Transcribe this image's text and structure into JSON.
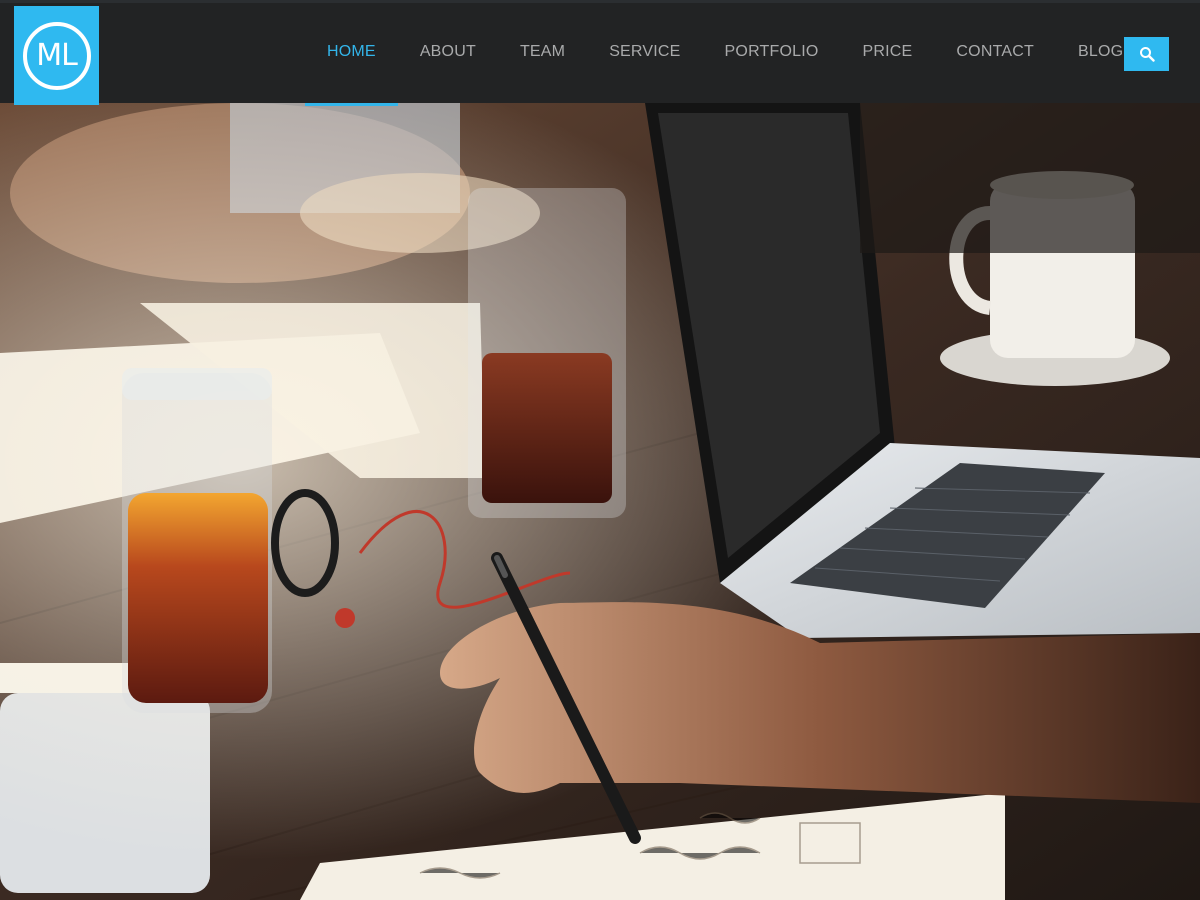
{
  "brand": {
    "logo_text": "ML",
    "accent_color": "#2fb9f0"
  },
  "nav": {
    "items": [
      {
        "label": "HOME",
        "active": true
      },
      {
        "label": "ABOUT",
        "active": false
      },
      {
        "label": "TEAM",
        "active": false
      },
      {
        "label": "SERVICE",
        "active": false
      },
      {
        "label": "PORTFOLIO",
        "active": false
      },
      {
        "label": "PRICE",
        "active": false
      },
      {
        "label": "CONTACT",
        "active": false
      },
      {
        "label": "BLOG",
        "active": false
      }
    ],
    "search_icon": "search-icon"
  },
  "hero": {
    "image_subject": "people working at a wooden table with laptop, drinks, notebook and pen"
  }
}
